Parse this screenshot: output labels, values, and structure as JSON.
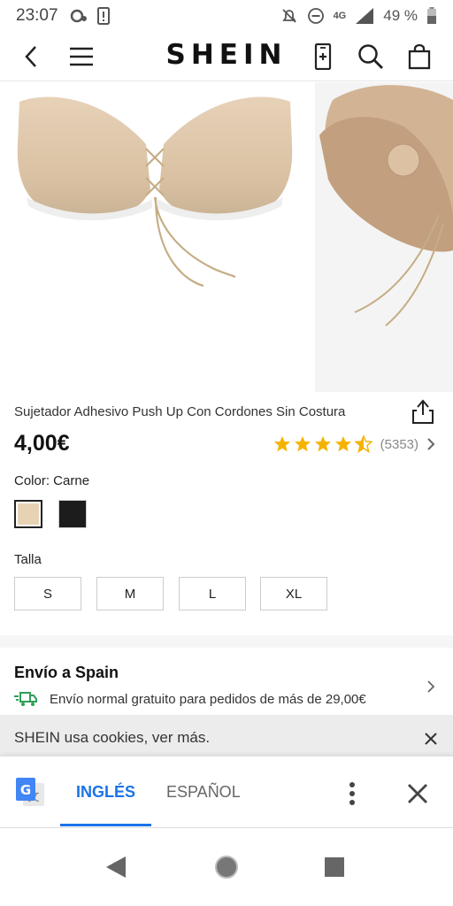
{
  "status_bar": {
    "time": "23:07",
    "network": "4G",
    "battery": "49 %"
  },
  "header": {
    "brand": "SHEIN",
    "icons": [
      "back-arrow-icon",
      "hamburger-menu-icon",
      "phone-add-icon",
      "search-icon",
      "shopping-bag-icon"
    ]
  },
  "product": {
    "title": "Sujetador Adhesivo Push Up Con Cordones Sin Costura",
    "price": "4,00€",
    "rating_stars": 4.5,
    "review_count": "(5353)",
    "color_label": "Color: Carne",
    "colors": [
      "#e8d2b4",
      "#1c1c1c"
    ],
    "size_label": "Talla",
    "sizes": [
      "S",
      "M",
      "L",
      "XL"
    ]
  },
  "shipping": {
    "title": "Envío a Spain",
    "text": "Envío normal gratuito para pedidos de más de 29,00€"
  },
  "cookie_banner": {
    "text": "SHEIN usa cookies, ver más."
  },
  "translate_bar": {
    "lang_selected": "INGLÉS",
    "lang_other": "ESPAÑOL",
    "accent": "#1a73e8"
  }
}
